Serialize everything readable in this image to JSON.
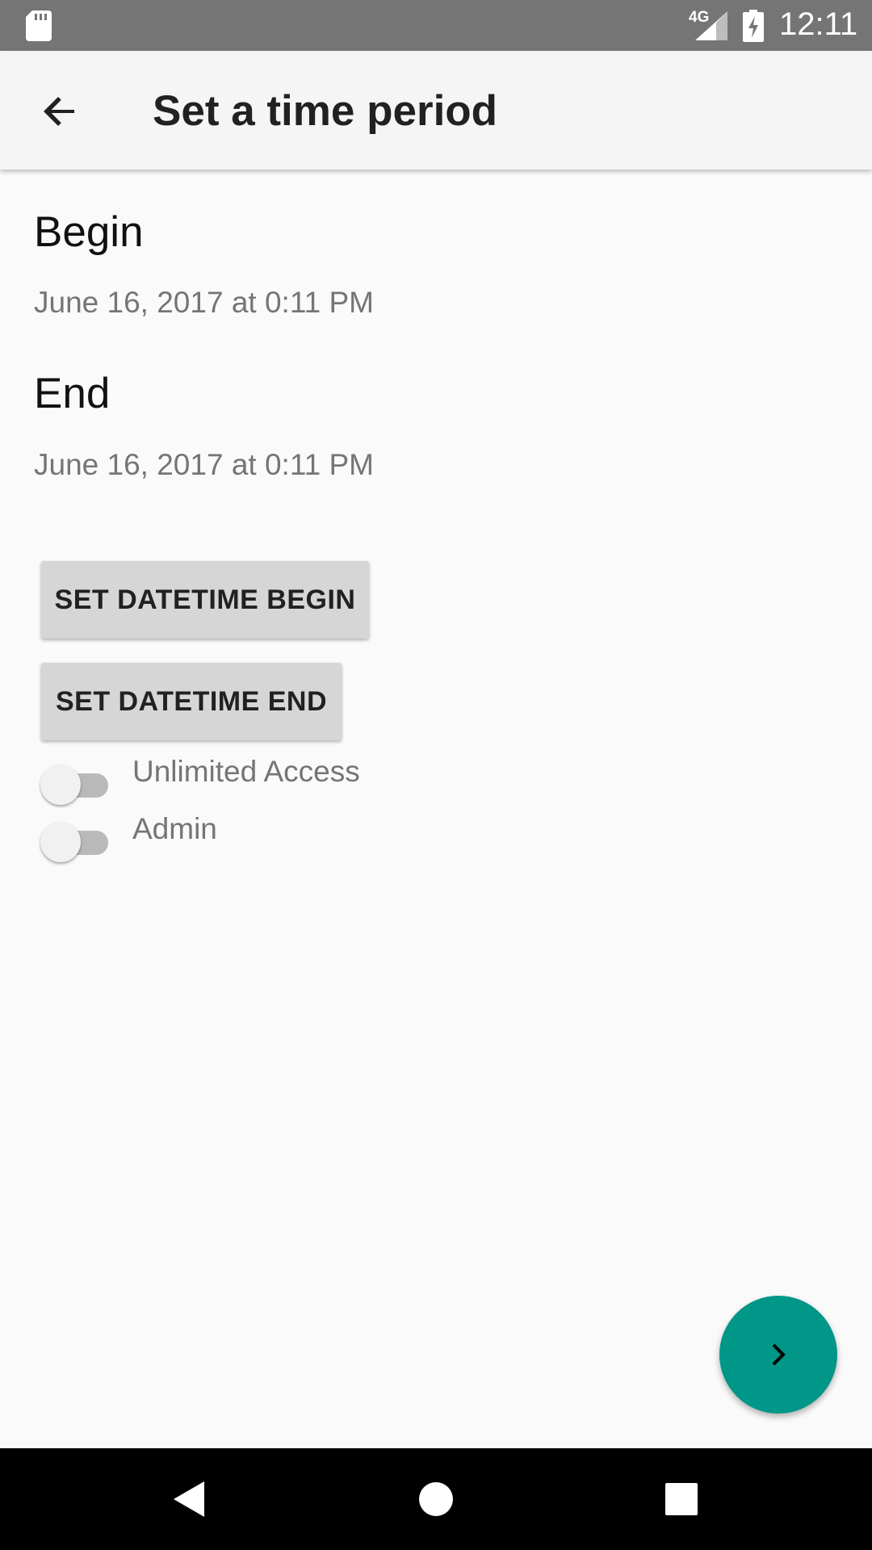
{
  "status_bar": {
    "network": "4G",
    "time": "12:11",
    "icons": [
      "sd-card-icon",
      "signal-icon",
      "battery-charging-icon"
    ]
  },
  "app_bar": {
    "title": "Set a time period",
    "back_icon": "arrow-back-icon"
  },
  "begin": {
    "heading": "Begin",
    "value": "June 16, 2017 at 0:11 PM"
  },
  "end": {
    "heading": "End",
    "value": "June 16, 2017 at 0:11 PM"
  },
  "buttons": {
    "set_begin": "SET DATETIME BEGIN",
    "set_end": "SET DATETIME END"
  },
  "switches": [
    {
      "label": "Unlimited Access",
      "checked": false
    },
    {
      "label": "Admin",
      "checked": false
    }
  ],
  "fab": {
    "icon": "chevron-right-icon",
    "color": "#009688"
  },
  "nav_bar": {
    "icons": [
      "nav-back-icon",
      "nav-home-icon",
      "nav-recents-icon"
    ]
  },
  "colors": {
    "status_bar": "#757575",
    "app_bar": "#f5f5f5",
    "accent": "#009688",
    "button": "#d6d6d6"
  }
}
